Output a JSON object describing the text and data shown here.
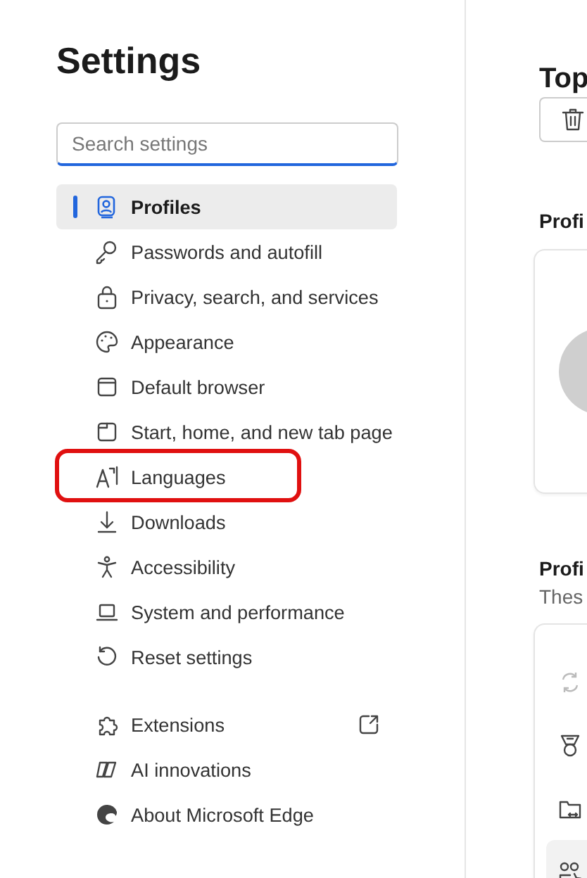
{
  "sidebar": {
    "title": "Settings",
    "search": {
      "placeholder": "Search settings"
    },
    "groups": [
      {
        "items": [
          {
            "label": "Profiles",
            "selected": true,
            "highlighted": false,
            "external": false
          },
          {
            "label": "Passwords and autofill",
            "selected": false,
            "highlighted": false,
            "external": false
          },
          {
            "label": "Privacy, search, and services",
            "selected": false,
            "highlighted": false,
            "external": false
          },
          {
            "label": "Appearance",
            "selected": false,
            "highlighted": false,
            "external": false
          },
          {
            "label": "Default browser",
            "selected": false,
            "highlighted": false,
            "external": false
          },
          {
            "label": "Start, home, and new tab page",
            "selected": false,
            "highlighted": false,
            "external": false
          },
          {
            "label": "Languages",
            "selected": false,
            "highlighted": true,
            "external": false
          },
          {
            "label": "Downloads",
            "selected": false,
            "highlighted": false,
            "external": false
          },
          {
            "label": "Accessibility",
            "selected": false,
            "highlighted": false,
            "external": false
          },
          {
            "label": "System and performance",
            "selected": false,
            "highlighted": false,
            "external": false
          },
          {
            "label": "Reset settings",
            "selected": false,
            "highlighted": false,
            "external": false
          }
        ]
      },
      {
        "items": [
          {
            "label": "Extensions",
            "selected": false,
            "highlighted": false,
            "external": true
          },
          {
            "label": "AI innovations",
            "selected": false,
            "highlighted": false,
            "external": false
          },
          {
            "label": "About Microsoft Edge",
            "selected": false,
            "highlighted": false,
            "external": false
          }
        ]
      }
    ]
  },
  "main": {
    "title": "Top",
    "section_1": {
      "heading": "Profi"
    },
    "section_2": {
      "heading": "Profi",
      "description": "Thes"
    }
  }
}
